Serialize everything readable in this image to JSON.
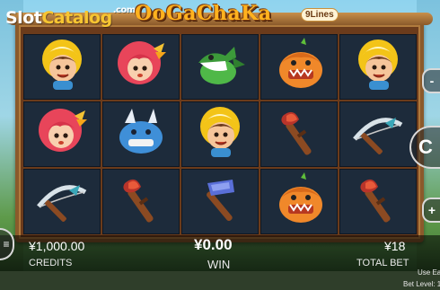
{
  "watermark": {
    "part1": "Slot",
    "part2": "Catalog",
    "part3": ".com"
  },
  "game": {
    "title": "OoGaChaKa",
    "lines_badge": "9Lines"
  },
  "reels": [
    [
      "caveboy",
      "cavegirl",
      "dino-green",
      "dino-orange",
      "caveboy"
    ],
    [
      "cavegirl",
      "dino-blue",
      "caveboy",
      "torch",
      "crossbow"
    ],
    [
      "crossbow",
      "torch",
      "hammer",
      "dino-orange",
      "torch"
    ]
  ],
  "credits": {
    "value": "¥1,000.00",
    "label": "CREDITS"
  },
  "win": {
    "value": "¥0.00",
    "label": "WIN"
  },
  "total_bet": {
    "value": "¥18",
    "label": "TOTAL BET"
  },
  "hints": {
    "line1": "Use Ea",
    "line2": "Bet Level: 1"
  },
  "buttons": {
    "minus": "-",
    "spin": "C",
    "plus": "+",
    "menu": "≡"
  },
  "colors": {
    "frame": "#8b5a2b",
    "reel_bg": "#1d2b3b",
    "logo": "#ffb21e"
  }
}
